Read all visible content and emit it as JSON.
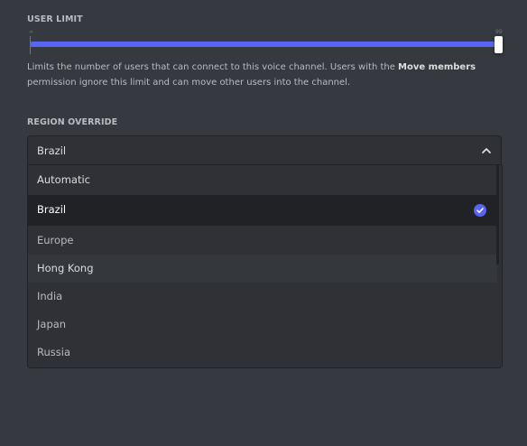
{
  "user_limit": {
    "title": "USER LIMIT",
    "min_label": "∞",
    "max_label": "99",
    "fill_fraction": 1.0,
    "description_pre": "Limits the number of users that can connect to this voice channel. Users with the ",
    "description_bold": "Move members",
    "description_post": " permission ignore this limit and can move other users into the channel."
  },
  "region_override": {
    "title": "REGION OVERRIDE",
    "selected_value": "Brazil",
    "options": [
      {
        "label": "Automatic"
      },
      {
        "label": "Brazil"
      },
      {
        "label": "Europe"
      },
      {
        "label": "Hong Kong"
      },
      {
        "label": "India"
      },
      {
        "label": "Japan"
      },
      {
        "label": "Russia"
      }
    ]
  },
  "colors": {
    "accent": "#5865f2",
    "background": "#36393f",
    "input_bg": "#2f3136"
  },
  "icons": {
    "chevron": "chevron-up-icon",
    "check": "check-circle-icon"
  }
}
